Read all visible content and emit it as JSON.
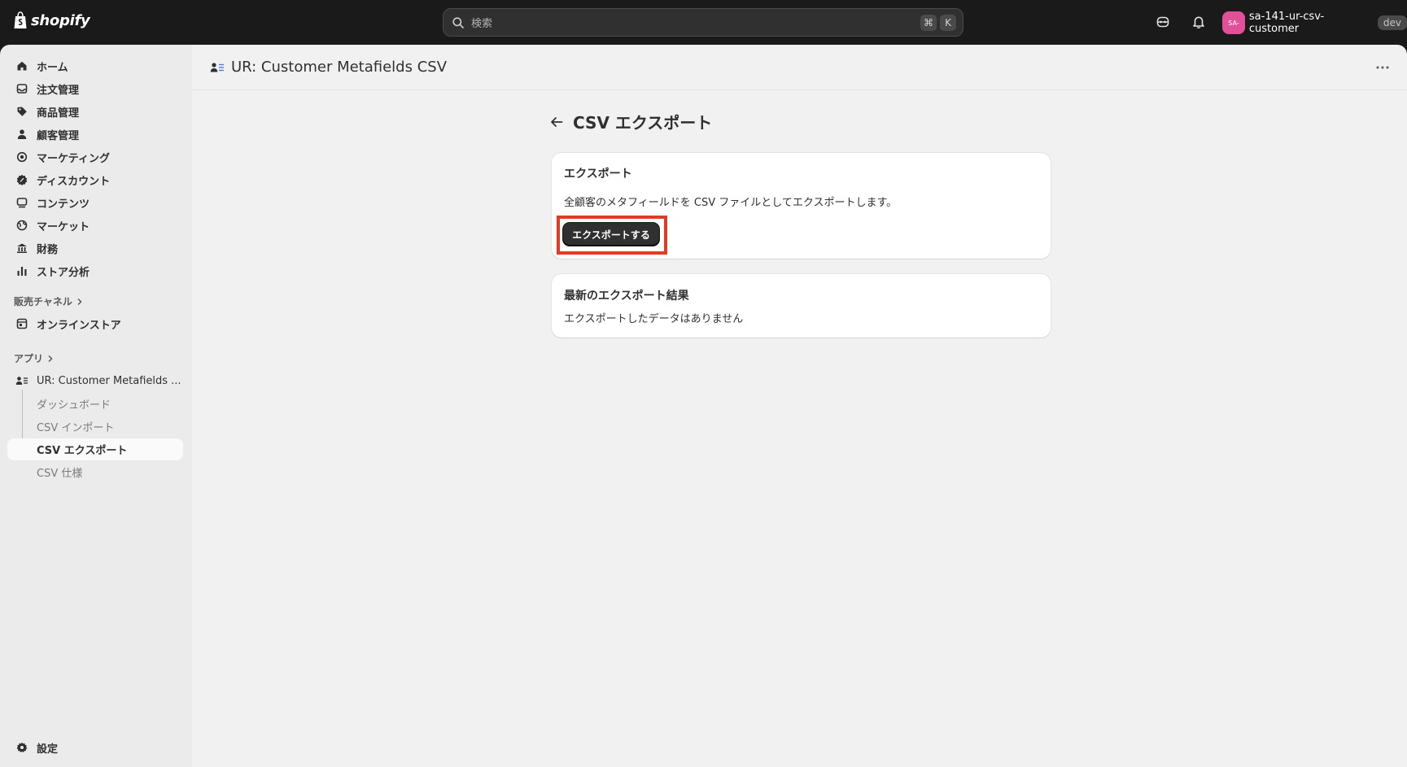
{
  "topbar": {
    "brand": "shopify",
    "search_placeholder": "検索",
    "shortcut_keys": [
      "⌘",
      "K"
    ],
    "store_avatar": "SA-",
    "store_name": "sa-141-ur-csv-customer",
    "store_badge": "dev"
  },
  "sidebar": {
    "items": [
      {
        "label": "ホーム",
        "icon": "home-icon"
      },
      {
        "label": "注文管理",
        "icon": "inbox-icon"
      },
      {
        "label": "商品管理",
        "icon": "tag-icon"
      },
      {
        "label": "顧客管理",
        "icon": "person-icon"
      },
      {
        "label": "マーケティング",
        "icon": "target-icon"
      },
      {
        "label": "ディスカウント",
        "icon": "discount-icon"
      },
      {
        "label": "コンテンツ",
        "icon": "content-icon"
      },
      {
        "label": "マーケット",
        "icon": "globe-icon"
      },
      {
        "label": "財務",
        "icon": "bank-icon"
      },
      {
        "label": "ストア分析",
        "icon": "chart-icon"
      }
    ],
    "sales_channels_label": "販売チャネル",
    "online_store_label": "オンラインストア",
    "apps_label": "アプリ",
    "app_name": "UR: Customer Metafields ...",
    "app_subitems": [
      "ダッシュボード",
      "CSV インポート",
      "CSV エクスポート",
      "CSV 仕様"
    ],
    "settings_label": "設定"
  },
  "main": {
    "app_title": "UR: Customer Metafields CSV",
    "page_title": "CSV エクスポート",
    "export_card": {
      "title": "エクスポート",
      "description": "全顧客のメタフィールドを CSV ファイルとしてエクスポートします。",
      "button_label": "エクスポートする"
    },
    "results_card": {
      "title": "最新のエクスポート結果",
      "empty_text": "エクスポートしたデータはありません"
    }
  },
  "colors": {
    "topbar_bg": "#1a1a1a",
    "sidebar_bg": "#ebebeb",
    "main_bg": "#f1f1f1",
    "primary_button": "#303030",
    "avatar": "#e2509a",
    "highlight": "#e03b24"
  }
}
